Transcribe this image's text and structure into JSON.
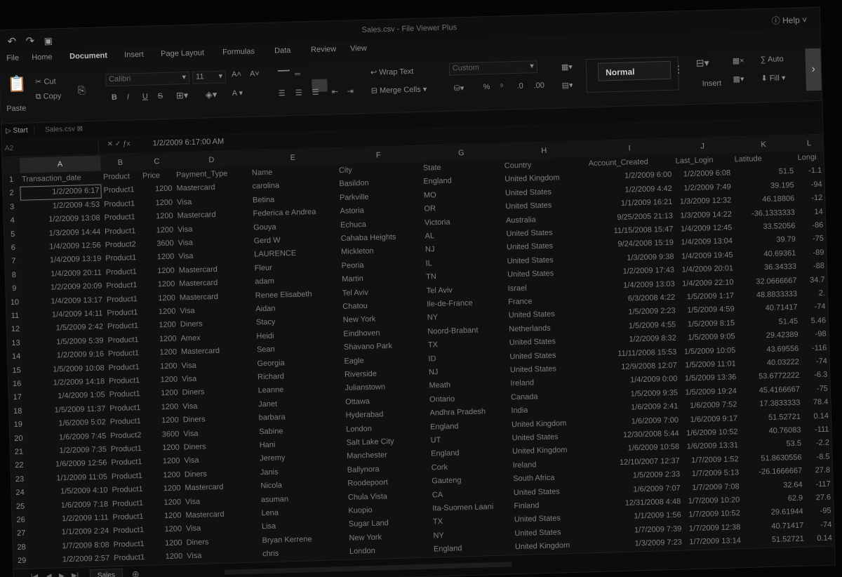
{
  "titlebar": {
    "title": "Sales.csv - File Viewer Plus",
    "help": "Help",
    "close": "×"
  },
  "menu": [
    "File",
    "Home",
    "Document",
    "Insert",
    "Page Layout",
    "Formulas",
    "Data",
    "Review",
    "View"
  ],
  "ribbon": {
    "paste": "Paste",
    "cut": "Cut",
    "copy": "Copy",
    "font": "Calibri",
    "size": "11",
    "wrap": "Wrap Text",
    "merge": "Merge Cells",
    "format": "Custom",
    "style": "Normal",
    "insert": "Insert",
    "autosum": "Auto",
    "fill": "Fill"
  },
  "tabs": {
    "start": "Start",
    "file": "Sales.csv"
  },
  "formula_bar": {
    "name_box": "A2",
    "value": "1/2/2009 6:17:00 AM"
  },
  "columns": [
    "A",
    "B",
    "C",
    "D",
    "E",
    "F",
    "G",
    "H",
    "I",
    "J",
    "K",
    "L"
  ],
  "header_row": [
    "Transaction_date",
    "Product",
    "Price",
    "Payment_Type",
    "Name",
    "City",
    "State",
    "Country",
    "Account_Created",
    "Last_Login",
    "Latitude",
    "Longi"
  ],
  "rows": [
    [
      "1/2/2009 6:17",
      "Product1",
      "1200",
      "Mastercard",
      "carolina",
      "Basildon",
      "England",
      "United Kingdom",
      "1/2/2009 6:00",
      "1/2/2009 6:08",
      "51.5",
      "-1.1"
    ],
    [
      "1/2/2009 4:53",
      "Product1",
      "1200",
      "Visa",
      "Betina",
      "Parkville",
      "MO",
      "United States",
      "1/2/2009 4:42",
      "1/2/2009 7:49",
      "39.195",
      "-94"
    ],
    [
      "1/2/2009 13:08",
      "Product1",
      "1200",
      "Mastercard",
      "Federica e Andrea",
      "Astoria",
      "OR",
      "United States",
      "1/1/2009 16:21",
      "1/3/2009 12:32",
      "46.18806",
      "-12"
    ],
    [
      "1/3/2009 14:44",
      "Product1",
      "1200",
      "Visa",
      "Gouya",
      "Echuca",
      "Victoria",
      "Australia",
      "9/25/2005 21:13",
      "1/3/2009 14:22",
      "-36.1333333",
      "14"
    ],
    [
      "1/4/2009 12:56",
      "Product2",
      "3600",
      "Visa",
      "Gerd W",
      "Cahaba Heights",
      "AL",
      "United States",
      "11/15/2008 15:47",
      "1/4/2009 12:45",
      "33.52056",
      "-86"
    ],
    [
      "1/4/2009 13:19",
      "Product1",
      "1200",
      "Visa",
      "LAURENCE",
      "Mickleton",
      "NJ",
      "United States",
      "9/24/2008 15:19",
      "1/4/2009 13:04",
      "39.79",
      "-75"
    ],
    [
      "1/4/2009 20:11",
      "Product1",
      "1200",
      "Mastercard",
      "Fleur",
      "Peoria",
      "IL",
      "United States",
      "1/3/2009 9:38",
      "1/4/2009 19:45",
      "40.69361",
      "-89"
    ],
    [
      "1/2/2009 20:09",
      "Product1",
      "1200",
      "Mastercard",
      "adam",
      "Martin",
      "TN",
      "United States",
      "1/2/2009 17:43",
      "1/4/2009 20:01",
      "36.34333",
      "-88"
    ],
    [
      "1/4/2009 13:17",
      "Product1",
      "1200",
      "Mastercard",
      "Renee Elisabeth",
      "Tel Aviv",
      "Tel Aviv",
      "Israel",
      "1/4/2009 13:03",
      "1/4/2009 22:10",
      "32.0666667",
      "34.7"
    ],
    [
      "1/4/2009 14:11",
      "Product1",
      "1200",
      "Visa",
      "Aidan",
      "Chatou",
      "Ile-de-France",
      "France",
      "6/3/2008 4:22",
      "1/5/2009 1:17",
      "48.8833333",
      "2."
    ],
    [
      "1/5/2009 2:42",
      "Product1",
      "1200",
      "Diners",
      "Stacy",
      "New York",
      "NY",
      "United States",
      "1/5/2009 2:23",
      "1/5/2009 4:59",
      "40.71417",
      "-74"
    ],
    [
      "1/5/2009 5:39",
      "Product1",
      "1200",
      "Amex",
      "Heidi",
      "Eindhoven",
      "Noord-Brabant",
      "Netherlands",
      "1/5/2009 4:55",
      "1/5/2009 8:15",
      "51.45",
      "5.46"
    ],
    [
      "1/2/2009 9:16",
      "Product1",
      "1200",
      "Mastercard",
      "Sean",
      "Shavano Park",
      "TX",
      "United States",
      "1/2/2009 8:32",
      "1/5/2009 9:05",
      "29.42389",
      "-98"
    ],
    [
      "1/5/2009 10:08",
      "Product1",
      "1200",
      "Visa",
      "Georgia",
      "Eagle",
      "ID",
      "United States",
      "11/11/2008 15:53",
      "1/5/2009 10:05",
      "43.69556",
      "-116"
    ],
    [
      "1/2/2009 14:18",
      "Product1",
      "1200",
      "Visa",
      "Richard",
      "Riverside",
      "NJ",
      "United States",
      "12/9/2008 12:07",
      "1/5/2009 11:01",
      "40.03222",
      "-74"
    ],
    [
      "1/4/2009 1:05",
      "Product1",
      "1200",
      "Diners",
      "Leanne",
      "Julianstown",
      "Meath",
      "Ireland",
      "1/4/2009 0:00",
      "1/5/2009 13:36",
      "53.6772222",
      "-6.3"
    ],
    [
      "1/5/2009 11:37",
      "Product1",
      "1200",
      "Visa",
      "Janet",
      "Ottawa",
      "Ontario",
      "Canada",
      "1/5/2009 9:35",
      "1/5/2009 19:24",
      "45.4166667",
      "-75"
    ],
    [
      "1/6/2009 5:02",
      "Product1",
      "1200",
      "Diners",
      "barbara",
      "Hyderabad",
      "Andhra Pradesh",
      "India",
      "1/6/2009 2:41",
      "1/6/2009 7:52",
      "17.3833333",
      "78.4"
    ],
    [
      "1/6/2009 7:45",
      "Product2",
      "3600",
      "Visa",
      "Sabine",
      "London",
      "England",
      "United Kingdom",
      "1/6/2009 7:00",
      "1/6/2009 9:17",
      "51.52721",
      "0.14"
    ],
    [
      "1/2/2009 7:35",
      "Product1",
      "1200",
      "Diners",
      "Hani",
      "Salt Lake City",
      "UT",
      "United States",
      "12/30/2008 5:44",
      "1/6/2009 10:52",
      "40.76083",
      "-111"
    ],
    [
      "1/6/2009 12:56",
      "Product1",
      "1200",
      "Visa",
      "Jeremy",
      "Manchester",
      "England",
      "United Kingdom",
      "1/6/2009 10:58",
      "1/6/2009 13:31",
      "53.5",
      "-2.2"
    ],
    [
      "1/1/2009 11:05",
      "Product1",
      "1200",
      "Diners",
      "Janis",
      "Ballynora",
      "Cork",
      "Ireland",
      "12/10/2007 12:37",
      "1/7/2009 1:52",
      "51.8630556",
      "-8.5"
    ],
    [
      "1/5/2009 4:10",
      "Product1",
      "1200",
      "Mastercard",
      "Nicola",
      "Roodepoort",
      "Gauteng",
      "South Africa",
      "1/5/2009 2:33",
      "1/7/2009 5:13",
      "-26.1666667",
      "27.8"
    ],
    [
      "1/6/2009 7:18",
      "Product1",
      "1200",
      "Visa",
      "asuman",
      "Chula Vista",
      "CA",
      "United States",
      "1/6/2009 7:07",
      "1/7/2009 7:08",
      "32.64",
      "-117"
    ],
    [
      "1/2/2009 1:11",
      "Product1",
      "1200",
      "Mastercard",
      "Lena",
      "Kuopio",
      "Ita-Suomen Laani",
      "Finland",
      "12/31/2008 4:48",
      "1/7/2009 10:20",
      "62.9",
      "27.6"
    ],
    [
      "1/1/2009 2:24",
      "Product1",
      "1200",
      "Visa",
      "Lisa",
      "Sugar Land",
      "TX",
      "United States",
      "1/1/2009 1:56",
      "1/7/2009 10:52",
      "29.61944",
      "-95"
    ],
    [
      "1/7/2009 8:08",
      "Product1",
      "1200",
      "Diners",
      "Bryan Kerrene",
      "New York",
      "NY",
      "United States",
      "1/7/2009 7:39",
      "1/7/2009 12:38",
      "40.71417",
      "-74"
    ],
    [
      "1/2/2009 2:57",
      "Product1",
      "1200",
      "Visa",
      "chris",
      "London",
      "England",
      "United Kingdom",
      "1/3/2009 7:23",
      "1/7/2009 13:14",
      "51.52721",
      "0.14"
    ]
  ],
  "sheet_tab": "Sales",
  "status_nav": [
    "|◀",
    "◀",
    "▶",
    "▶|"
  ]
}
